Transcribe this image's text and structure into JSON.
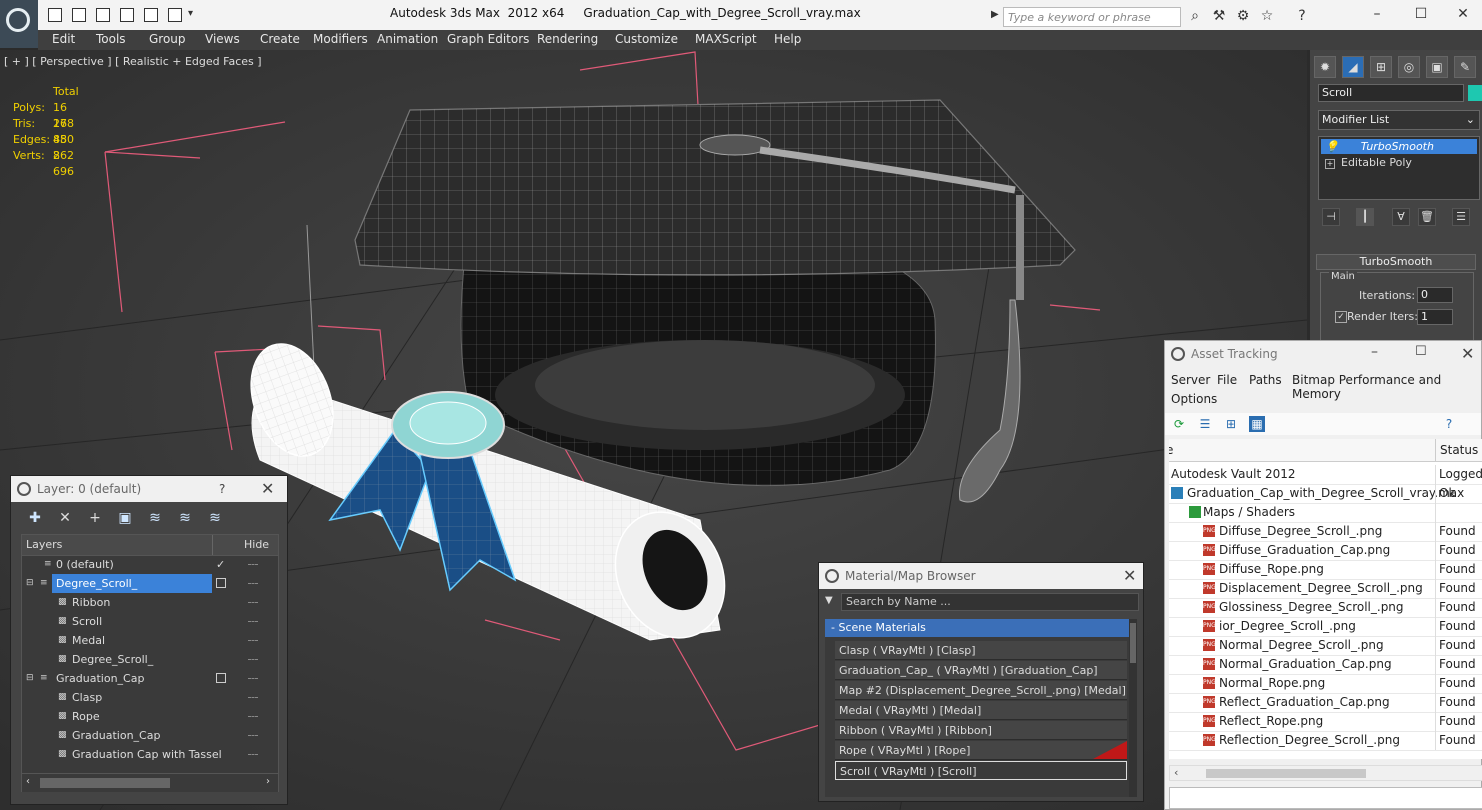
{
  "app": {
    "title": "Autodesk 3ds Max  2012 x64     Graduation_Cap_with_Degree_Scroll_vray.max",
    "search_placeholder": "Type a keyword or phrase"
  },
  "menu": [
    "Edit",
    "Tools",
    "Group",
    "Views",
    "Create",
    "Modifiers",
    "Animation",
    "Graph Editors",
    "Rendering",
    "Customize",
    "MAXScript",
    "Help"
  ],
  "viewport": {
    "label": "[ + ] [ Perspective ] [ Realistic + Edged Faces ]",
    "stats": {
      "header": "Total",
      "rows": [
        {
          "label": "Polys:",
          "value": "16 278"
        },
        {
          "label": "Tris:",
          "value": "16 850"
        },
        {
          "label": "Edges:",
          "value": "48 262"
        },
        {
          "label": "Verts:",
          "value": "8 696"
        }
      ]
    }
  },
  "command_panel": {
    "object_name": "Scroll",
    "object_color": "#1ec8b0",
    "modifier_list": "Modifier List",
    "stack": [
      "TurboSmooth",
      "Editable Poly"
    ],
    "rollout": "TurboSmooth",
    "group": "Main",
    "iterations_label": "Iterations:",
    "iterations_value": "0",
    "render_iters_label": "Render Iters:",
    "render_iters_value": "1"
  },
  "layer_window": {
    "title": "Layer: 0 (default)",
    "help": "?",
    "col_layers": "Layers",
    "col_hide": "Hide",
    "rows": [
      {
        "name": "0 (default)",
        "level": 1
      },
      {
        "name": "Degree_Scroll_",
        "level": 0
      },
      {
        "name": "Ribbon",
        "level": 2
      },
      {
        "name": "Scroll",
        "level": 2
      },
      {
        "name": "Medal",
        "level": 2
      },
      {
        "name": "Degree_Scroll_",
        "level": 2
      },
      {
        "name": "Graduation_Cap",
        "level": 0
      },
      {
        "name": "Clasp",
        "level": 2
      },
      {
        "name": "Rope",
        "level": 2
      },
      {
        "name": "Graduation_Cap",
        "level": 2
      },
      {
        "name": "Graduation Cap with Tassel",
        "level": 2
      }
    ]
  },
  "material_browser": {
    "title": "Material/Map Browser",
    "search_placeholder": "Search by Name ...",
    "group": "- Scene Materials",
    "items": [
      "Clasp  ( VRayMtl ) [Clasp]",
      "Graduation_Cap_  ( VRayMtl ) [Graduation_Cap]",
      "Map #2 (Displacement_Degree_Scroll_.png) [Medal]",
      "Medal  ( VRayMtl ) [Medal]",
      "Ribbon  ( VRayMtl ) [Ribbon]",
      "Rope  ( VRayMtl ) [Rope]",
      "Scroll  ( VRayMtl ) [Scroll]"
    ]
  },
  "asset_tracking": {
    "title": "Asset Tracking",
    "menu": [
      "Server",
      "File",
      "Paths",
      "Bitmap Performance and Memory",
      "Options"
    ],
    "col_name": "e",
    "col_status": "Status",
    "rows": [
      {
        "name": "Autodesk Vault 2012",
        "status": "Logged",
        "indent": 0
      },
      {
        "name": "Graduation_Cap_with_Degree_Scroll_vray.max",
        "status": "Ok",
        "indent": 1
      },
      {
        "name": "Maps / Shaders",
        "status": "",
        "indent": 2
      },
      {
        "name": "Diffuse_Degree_Scroll_.png",
        "status": "Found",
        "indent": 3
      },
      {
        "name": "Diffuse_Graduation_Cap.png",
        "status": "Found",
        "indent": 3
      },
      {
        "name": "Diffuse_Rope.png",
        "status": "Found",
        "indent": 3
      },
      {
        "name": "Displacement_Degree_Scroll_.png",
        "status": "Found",
        "indent": 3
      },
      {
        "name": "Glossiness_Degree_Scroll_.png",
        "status": "Found",
        "indent": 3
      },
      {
        "name": "ior_Degree_Scroll_.png",
        "status": "Found",
        "indent": 3
      },
      {
        "name": "Normal_Degree_Scroll_.png",
        "status": "Found",
        "indent": 3
      },
      {
        "name": "Normal_Graduation_Cap.png",
        "status": "Found",
        "indent": 3
      },
      {
        "name": "Normal_Rope.png",
        "status": "Found",
        "indent": 3
      },
      {
        "name": "Reflect_Graduation_Cap.png",
        "status": "Found",
        "indent": 3
      },
      {
        "name": "Reflect_Rope.png",
        "status": "Found",
        "indent": 3
      },
      {
        "name": "Reflection_Degree_Scroll_.png",
        "status": "Found",
        "indent": 3
      }
    ]
  }
}
